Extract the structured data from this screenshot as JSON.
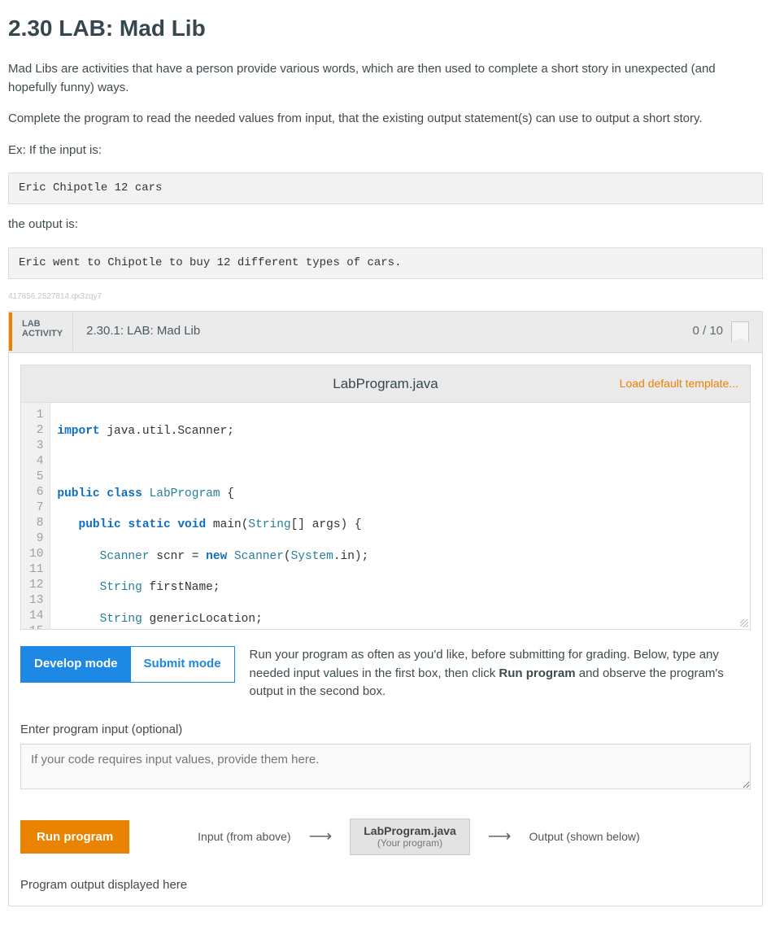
{
  "title": "2.30 LAB: Mad Lib",
  "intro1": "Mad Libs are activities that have a person provide various words, which are then used to complete a short story in unexpected (and hopefully funny) ways.",
  "intro2": "Complete the program to read the needed values from input, that the existing output statement(s) can use to output a short story.",
  "ex_label": "Ex: If the input is:",
  "ex_input": "Eric Chipotle 12 cars",
  "output_label": "the output is:",
  "ex_output": "Eric went to Chipotle to buy 12 different types of cars.",
  "hash": "417856.2527814.qx3zqy7",
  "activity": {
    "badge1": "LAB",
    "badge2": "ACTIVITY",
    "title": "2.30.1: LAB: Mad Lib",
    "score": "0 / 10"
  },
  "file": {
    "name": "LabProgram.java",
    "load_template": "Load default template..."
  },
  "code_lines": 15,
  "mode": {
    "develop": "Develop mode",
    "submit": "Submit mode",
    "help_a": "Run your program as often as you'd like, before submitting for grading. Below, type any needed input values in the first box, then click ",
    "help_b": "Run program",
    "help_c": " and observe the program's output in the second box."
  },
  "input": {
    "label": "Enter program input (optional)",
    "placeholder": "If your code requires input values, provide them here."
  },
  "run": {
    "button": "Run program",
    "input_label": "Input (from above)",
    "box_title": "LabProgram.java",
    "box_sub": "(Your program)",
    "output_label": "Output (shown below)"
  },
  "output_section": "Program output displayed here"
}
